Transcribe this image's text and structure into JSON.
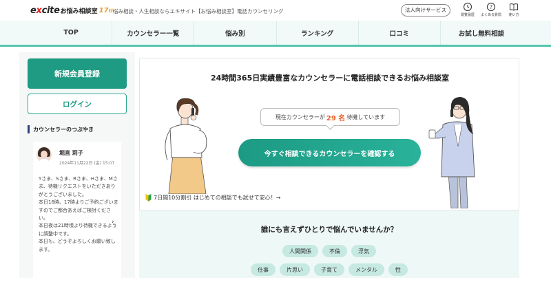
{
  "header": {
    "logo": {
      "excite": "excite",
      "name": "お悩み相談室",
      "years": "17",
      "years_suffix": "th"
    },
    "tagline": "悩み相談・人生相談ならエキサイト【お悩み相談室】電話カウンセリング",
    "corporate_button": "法人向けサービス",
    "icons": [
      {
        "name": "history-icon",
        "label": "閲覧履歴"
      },
      {
        "name": "help-icon",
        "label": "よくある質問"
      },
      {
        "name": "book-icon",
        "label": "使い方"
      }
    ]
  },
  "nav": {
    "items": [
      "TOP",
      "カウンセラー一覧",
      "悩み別",
      "ランキング",
      "口コミ",
      "お試し無料相談"
    ]
  },
  "sidebar": {
    "register_button": "新規会員登録",
    "login_button": "ログイン",
    "tweets_heading": "カウンセラーのつぶやき",
    "tweet": {
      "counselor_name": "堀直 莉子",
      "date": "2024年11月22日 (金) 15:07",
      "text": "Yさま、Sさま、Rさま、Hさま、Mさま、待機リクエストをいただきありがとうございました。\n本日16時、17時よりご予約ございますのでご都合あえばご検討ください。\n本日夜は21時頃より待機できるように調整中です。\n本日も、どうぞよろしくお願い致します。"
    },
    "next_icon": "›"
  },
  "hero": {
    "title": "24時間365日実績豊富なカウンセラーに電話相談できるお悩み相談室",
    "status_prefix": "現在カウンセラーが",
    "status_count": "29 名",
    "status_suffix": "待機しています",
    "cta_button": "今すぐ相談できるカウンセラーを確認する",
    "promo": "7日間10分割引 はじめての相談でも試せて安心！→"
  },
  "worries": {
    "title": "誰にも言えずひとりで悩んでいませんか？",
    "row1": [
      "人間関係",
      "不倫",
      "浮気"
    ],
    "row2": [
      "仕事",
      "片思い",
      "子育て",
      "メンタル",
      "性"
    ]
  },
  "colors": {
    "accent": "#1e9b82",
    "nav_bg": "#f1faf8",
    "status_count": "#e8612a",
    "tag_bg": "#c6e9e1"
  }
}
